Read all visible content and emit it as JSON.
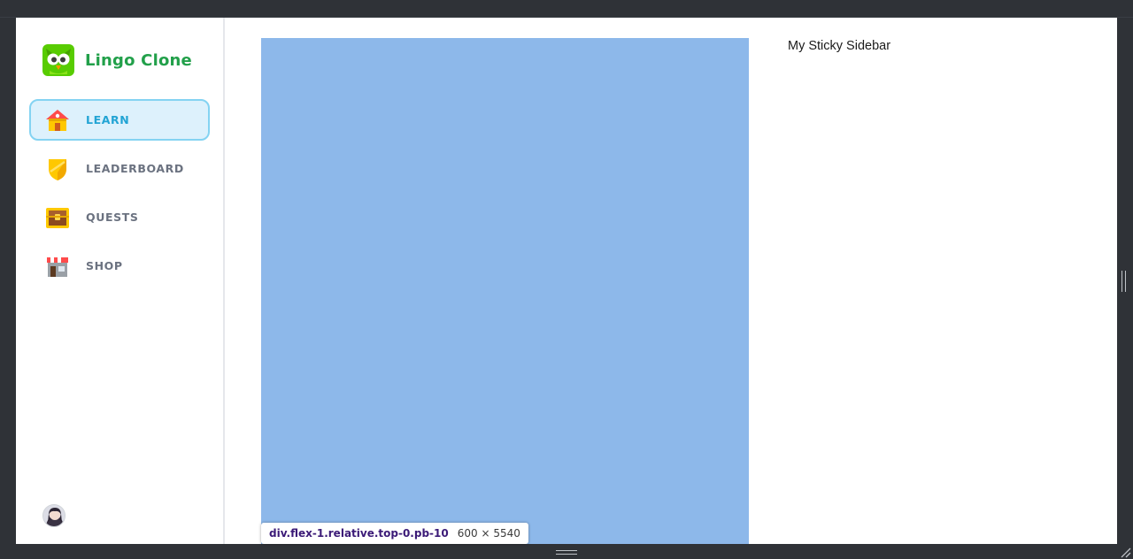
{
  "app": {
    "brand_name": "Lingo Clone"
  },
  "sidebar": {
    "items": [
      {
        "label": "LEARN",
        "icon": "learn-house-icon",
        "active": true
      },
      {
        "label": "LEADERBOARD",
        "icon": "leaderboard-shield-icon",
        "active": false
      },
      {
        "label": "QUESTS",
        "icon": "quests-chest-icon",
        "active": false
      },
      {
        "label": "SHOP",
        "icon": "shop-store-icon",
        "active": false
      }
    ]
  },
  "right_panel": {
    "title": "My Sticky Sidebar"
  },
  "inspector": {
    "selector": "div.flex-1.relative.top-0.pb-10",
    "dimensions": "600 × 5540"
  },
  "colors": {
    "brand_green": "#22a04a",
    "active_bg": "#ddf1fc",
    "active_border": "#84d3f2",
    "active_text": "#22a4d4",
    "content_block": "#8db8ea",
    "nav_text": "#6b7280"
  }
}
